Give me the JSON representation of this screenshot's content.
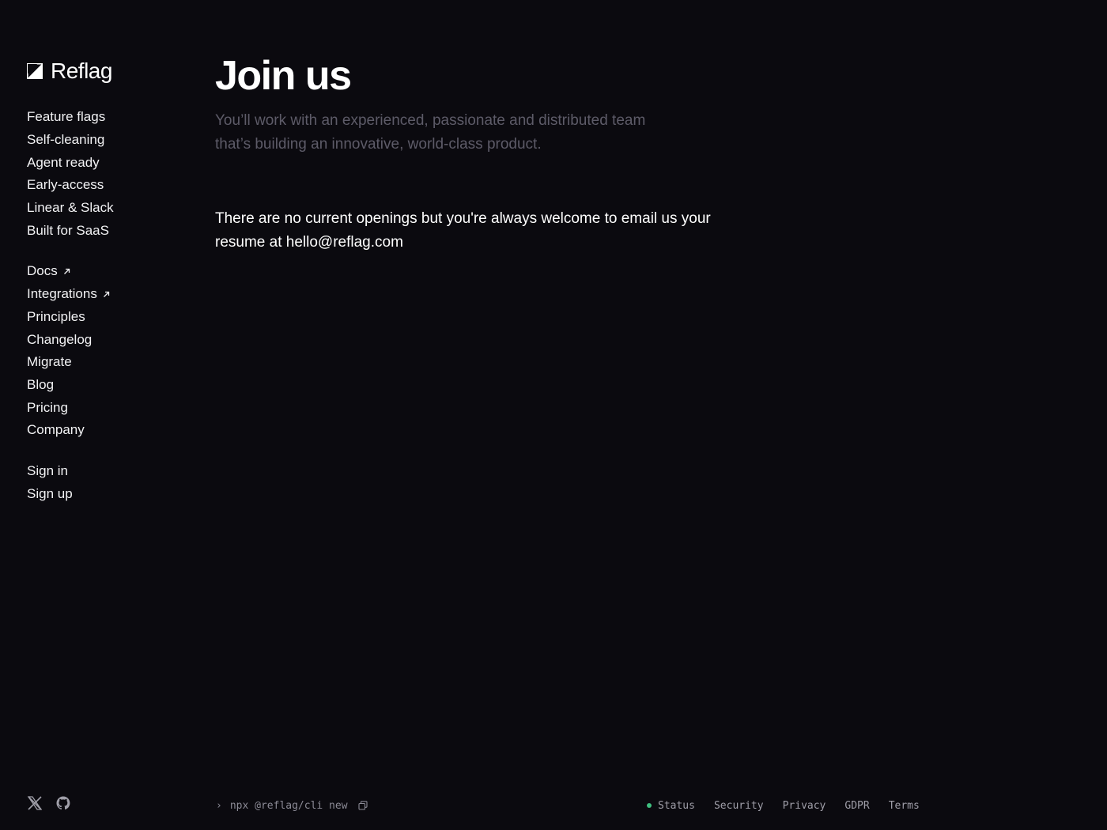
{
  "brand": {
    "name": "Reflag"
  },
  "sidebar": {
    "primary": [
      {
        "label": "Feature flags"
      },
      {
        "label": "Self-cleaning"
      },
      {
        "label": "Agent ready"
      },
      {
        "label": "Early-access"
      },
      {
        "label": "Linear & Slack"
      },
      {
        "label": "Built for SaaS"
      }
    ],
    "secondary": [
      {
        "label": "Docs",
        "external": true
      },
      {
        "label": "Integrations",
        "external": true
      },
      {
        "label": "Principles"
      },
      {
        "label": "Changelog"
      },
      {
        "label": "Migrate"
      },
      {
        "label": "Blog"
      },
      {
        "label": "Pricing"
      },
      {
        "label": "Company"
      }
    ],
    "auth": [
      {
        "label": "Sign in"
      },
      {
        "label": "Sign up"
      }
    ]
  },
  "main": {
    "title": "Join us",
    "subtitle": "You’ll work with an experienced, passionate and distributed team that’s building an innovative, world-class product.",
    "body": "There are no current openings but you're always welcome to email us your resume at hello@reflag.com"
  },
  "footer": {
    "social": [
      {
        "icon": "x-twitter-icon"
      },
      {
        "icon": "github-icon"
      }
    ],
    "cli": {
      "prompt": "›",
      "command": "npx @reflag/cli new",
      "icon": "copy-icon"
    },
    "links": [
      {
        "label": "Status"
      },
      {
        "label": "Security"
      },
      {
        "label": "Privacy"
      },
      {
        "label": "GDPR"
      },
      {
        "label": "Terms"
      }
    ],
    "status_color": "#3fbf7f"
  },
  "colors": {
    "background": "#0b0a0f",
    "text": "#ffffff",
    "muted": "#5d5b68"
  }
}
